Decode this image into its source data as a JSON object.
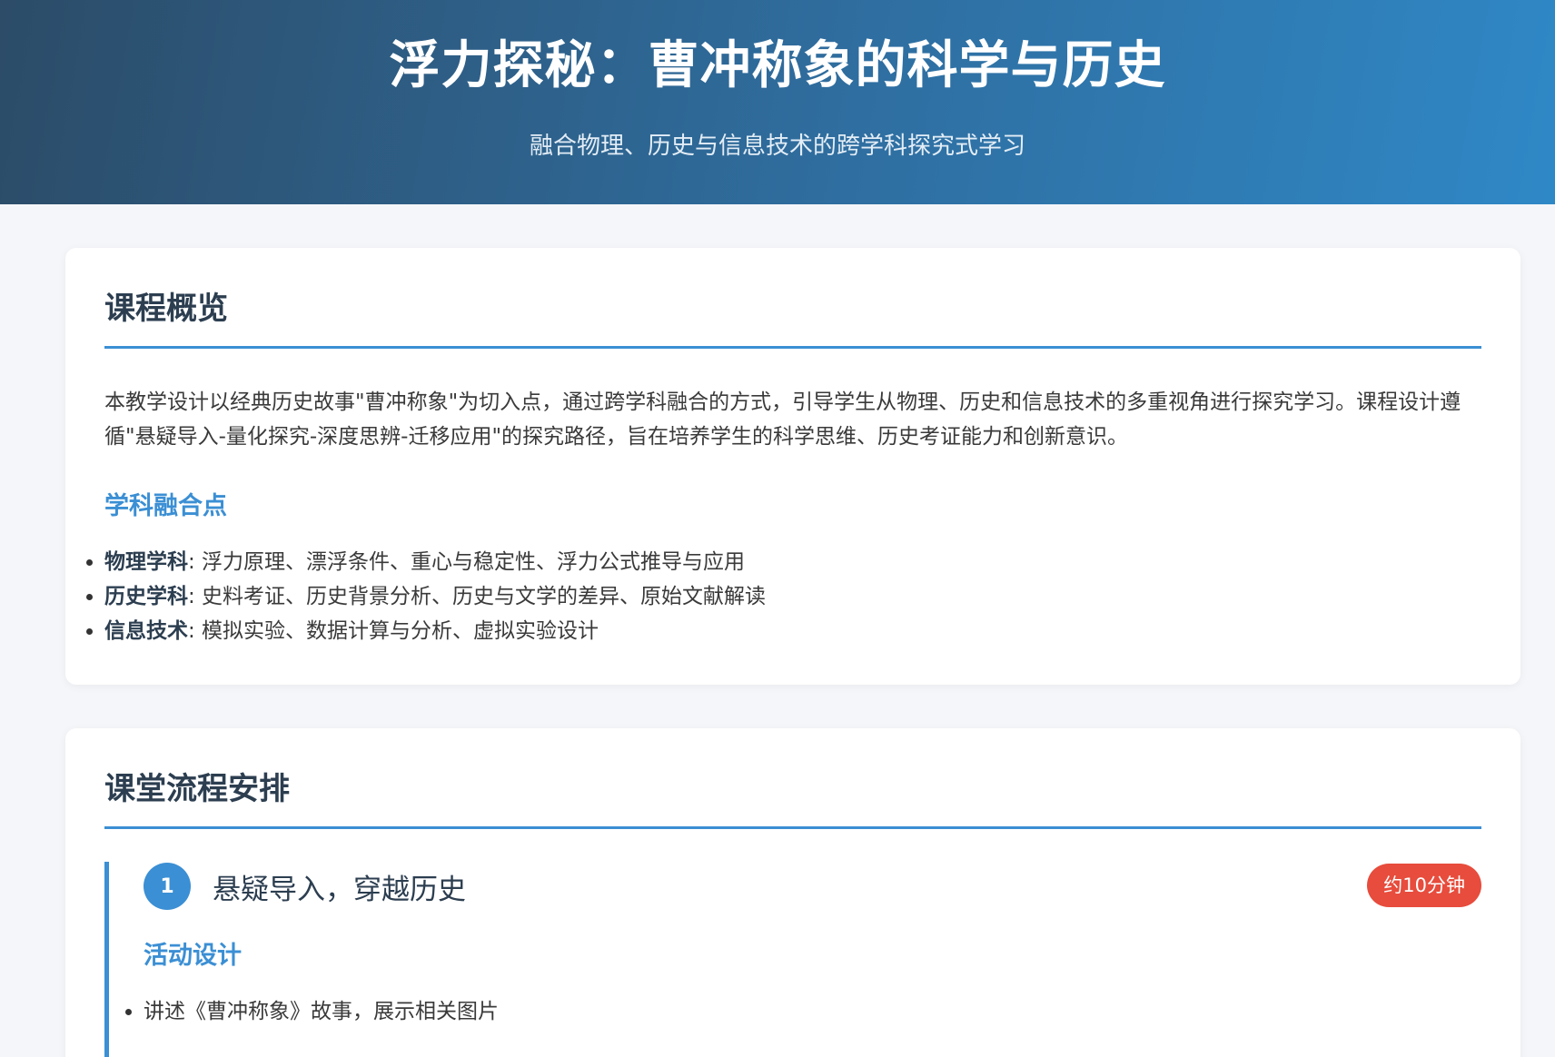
{
  "header": {
    "title": "浮力探秘：曹冲称象的科学与历史",
    "subtitle": "融合物理、历史与信息技术的跨学科探究式学习"
  },
  "overview": {
    "heading": "课程概览",
    "intro": "本教学设计以经典历史故事\"曹冲称象\"为切入点，通过跨学科融合的方式，引导学生从物理、历史和信息技术的多重视角进行探究学习。课程设计遵循\"悬疑导入-量化探究-深度思辨-迁移应用\"的探究路径，旨在培养学生的科学思维、历史考证能力和创新意识。",
    "subheading": "学科融合点",
    "items": [
      {
        "label": "物理学科",
        "text": ": 浮力原理、漂浮条件、重心与稳定性、浮力公式推导与应用"
      },
      {
        "label": "历史学科",
        "text": ": 史料考证、历史背景分析、历史与文学的差异、原始文献解读"
      },
      {
        "label": "信息技术",
        "text": ": 模拟实验、数据计算与分析、虚拟实验设计"
      }
    ]
  },
  "flow": {
    "heading": "课堂流程安排",
    "steps": [
      {
        "number": "1",
        "title": "悬疑导入，穿越历史",
        "duration": "约10分钟",
        "activity_heading": "活动设计",
        "activities": [
          "讲述《曹冲称象》故事，展示相关图片"
        ]
      }
    ]
  }
}
